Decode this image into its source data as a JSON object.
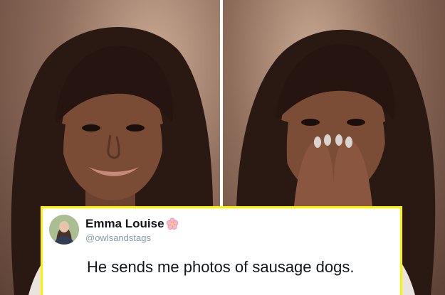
{
  "tweet": {
    "author_name": "Emma Louise",
    "handle": "@owlsandstags",
    "text": "He sends me photos of sausage dogs.",
    "name_badge_icon": "cherry-blossom-icon",
    "accent_color": "#fff200"
  },
  "photos": [
    {
      "name": "photo-smiling",
      "icon": "photo"
    },
    {
      "name": "photo-covering-mouth",
      "icon": "photo"
    }
  ]
}
